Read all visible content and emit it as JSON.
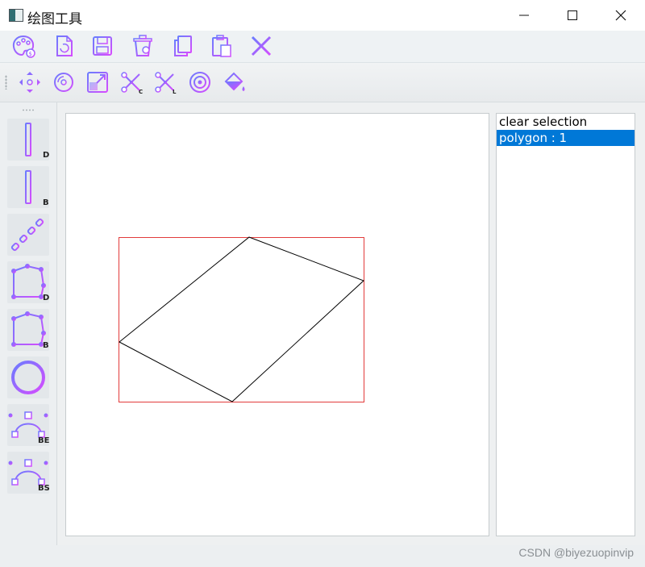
{
  "window": {
    "title": "绘图工具",
    "controls": [
      "minimize",
      "maximize",
      "close"
    ]
  },
  "toolbar_main": {
    "buttons": [
      {
        "name": "palette-icon"
      },
      {
        "name": "reload-file-icon"
      },
      {
        "name": "save-icon"
      },
      {
        "name": "recycle-bin-icon"
      },
      {
        "name": "copy-icon"
      },
      {
        "name": "paste-icon"
      },
      {
        "name": "delete-x-icon"
      }
    ]
  },
  "toolbar_edit": {
    "buttons": [
      {
        "name": "move-icon"
      },
      {
        "name": "rotate-icon"
      },
      {
        "name": "scale-icon"
      },
      {
        "name": "clip-c-icon",
        "sub": "C"
      },
      {
        "name": "clip-l-icon",
        "sub": "L"
      },
      {
        "name": "view-icon"
      },
      {
        "name": "fill-bucket-icon"
      }
    ]
  },
  "toolbar_draw": {
    "buttons": [
      {
        "name": "line-dda-icon",
        "sub": "D"
      },
      {
        "name": "line-bresenham-icon",
        "sub": "B"
      },
      {
        "name": "dotted-line-icon",
        "sub": ""
      },
      {
        "name": "polygon-dda-icon",
        "sub": "D"
      },
      {
        "name": "polygon-bresenham-icon",
        "sub": "B"
      },
      {
        "name": "circle-icon",
        "sub": ""
      },
      {
        "name": "curve-bezier-icon",
        "sub": "BE"
      },
      {
        "name": "curve-bspline-icon",
        "sub": "BS"
      }
    ]
  },
  "canvas": {
    "shape": "polygon",
    "stroke_color": "#000000",
    "selection_color": "#e23b3b"
  },
  "list": {
    "items": [
      {
        "label": "clear selection",
        "selected": false
      },
      {
        "label": "polygon : 1",
        "selected": true
      }
    ],
    "selected_color": "#0078d7"
  },
  "watermark": "CSDN @biyezuopinvip",
  "colors": {
    "icon_gradient_start": "#6a7cff",
    "icon_gradient_end": "#d64cff"
  }
}
